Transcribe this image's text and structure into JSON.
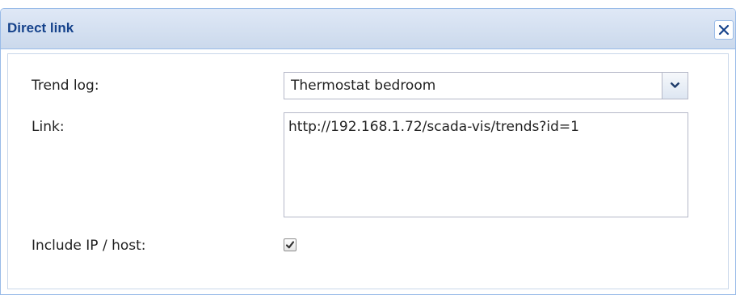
{
  "dialog": {
    "title": "Direct link",
    "close_icon": "close-icon"
  },
  "form": {
    "trend_log": {
      "label": "Trend log:",
      "value": "Thermostat bedroom",
      "trigger_icon": "chevron-down-icon"
    },
    "link": {
      "label": "Link:",
      "value": "http://192.168.1.72/scada-vis/trends?id=1"
    },
    "include_host": {
      "label": "Include IP / host:",
      "checked": true,
      "icon": "checkmark-icon"
    }
  },
  "colors": {
    "title_text": "#15428b",
    "header_bg": "#cbd9ec",
    "border": "#99bbe8"
  }
}
